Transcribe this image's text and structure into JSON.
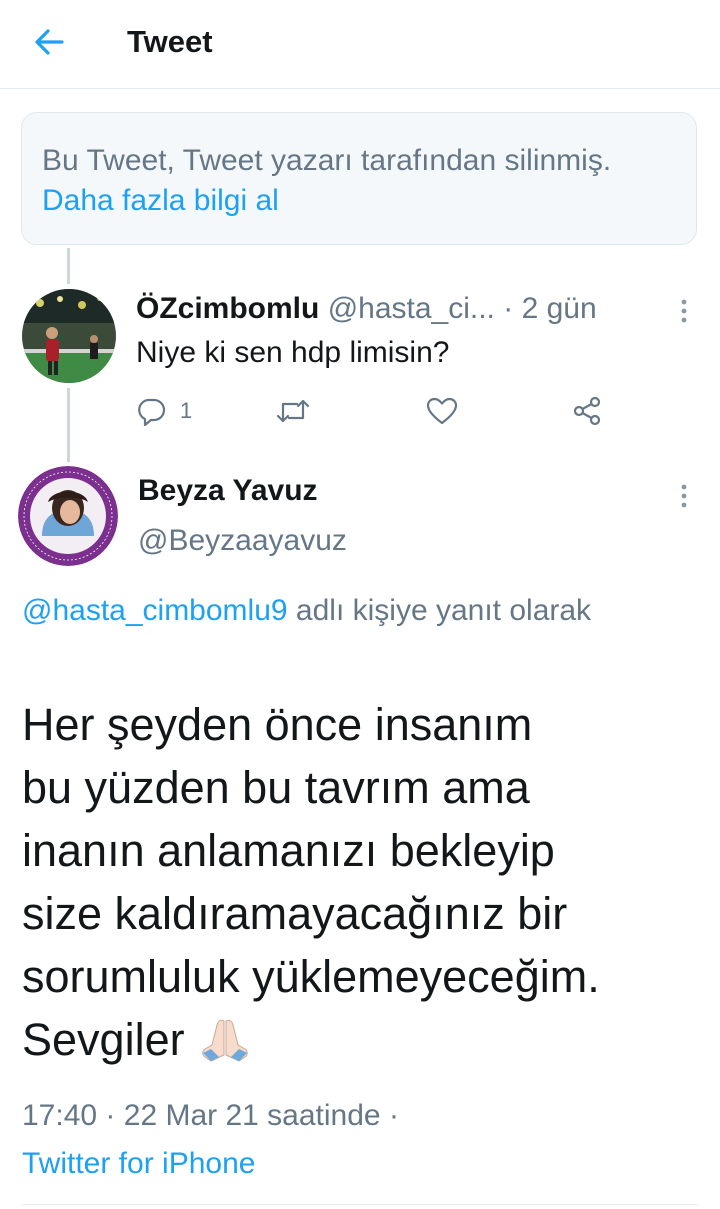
{
  "header": {
    "title": "Tweet"
  },
  "deleted_notice": {
    "text": "Bu Tweet, Tweet yazarı tarafından silinmiş.",
    "link": "Daha fazla bilgi al"
  },
  "reply_tweet": {
    "name": "ÖZcimbomlu",
    "handle": "@hasta_ci...",
    "separator": "·",
    "time": "2 gün",
    "text": "Niye ki sen hdp limisin?",
    "reply_count": "1",
    "icons": {
      "reply": "reply-icon",
      "retweet": "retweet-icon",
      "like": "heart-icon",
      "share": "share-icon",
      "more": "more-vertical-icon"
    }
  },
  "main_tweet": {
    "name": "Beyza Yavuz",
    "handle": "@Beyzaayavuz",
    "reply_to_handle": "@hasta_cimbomlu9",
    "reply_to_suffix": "adlı kişiye yanıt olarak",
    "body_lines": [
      "Her şeyden önce insanım",
      "bu yüzden bu tavrım ama",
      "inanın anlamanızı bekleyip",
      "size kaldıramayacağınız bir",
      "sorumluluk yüklemeyeceğim.",
      "Sevgiler"
    ],
    "emoji": "folded-hands-emoji",
    "time": "17:40",
    "separator": "·",
    "date": "22 Mar 21 saatinde",
    "separator2": "·",
    "source": "Twitter for iPhone"
  },
  "colors": {
    "accent": "#1da1f2",
    "muted": "#657786",
    "text": "#14171a",
    "border": "#e6ecf0",
    "notice_bg": "#f5f8fa"
  }
}
